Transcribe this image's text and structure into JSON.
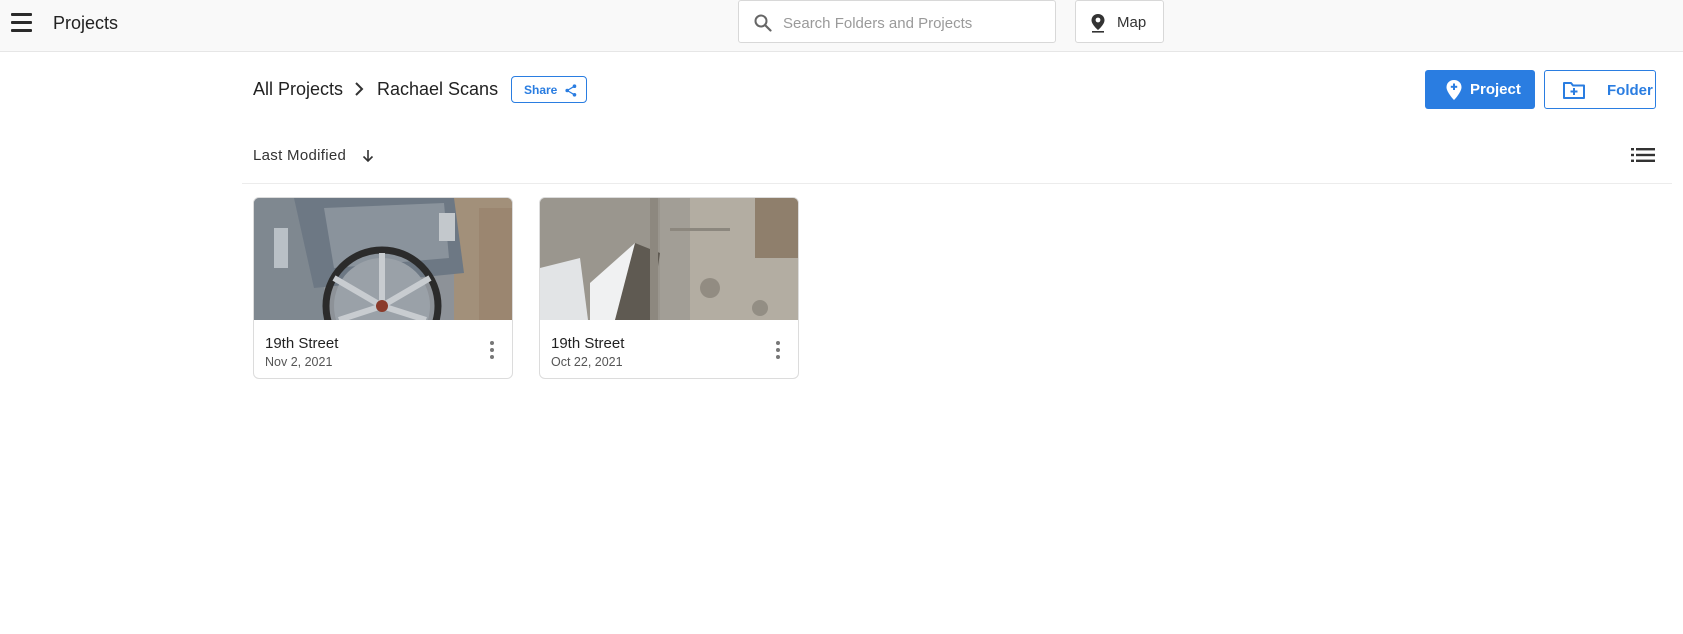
{
  "header": {
    "title": "Projects",
    "search_placeholder": "Search Folders and Projects",
    "search_value": "",
    "map_label": "Map"
  },
  "breadcrumb": {
    "root": "All Projects",
    "current": "Rachael Scans",
    "share_label": "Share"
  },
  "actions": {
    "project_label": "Project",
    "folder_label": "Folder"
  },
  "sort": {
    "label": "Last Modified"
  },
  "projects": [
    {
      "name": "19th Street",
      "date": "Nov 2, 2021"
    },
    {
      "name": "19th Street",
      "date": "Oct 22, 2021"
    }
  ],
  "colors": {
    "accent": "#2a7de1",
    "header_bg": "#f9f9f9"
  }
}
